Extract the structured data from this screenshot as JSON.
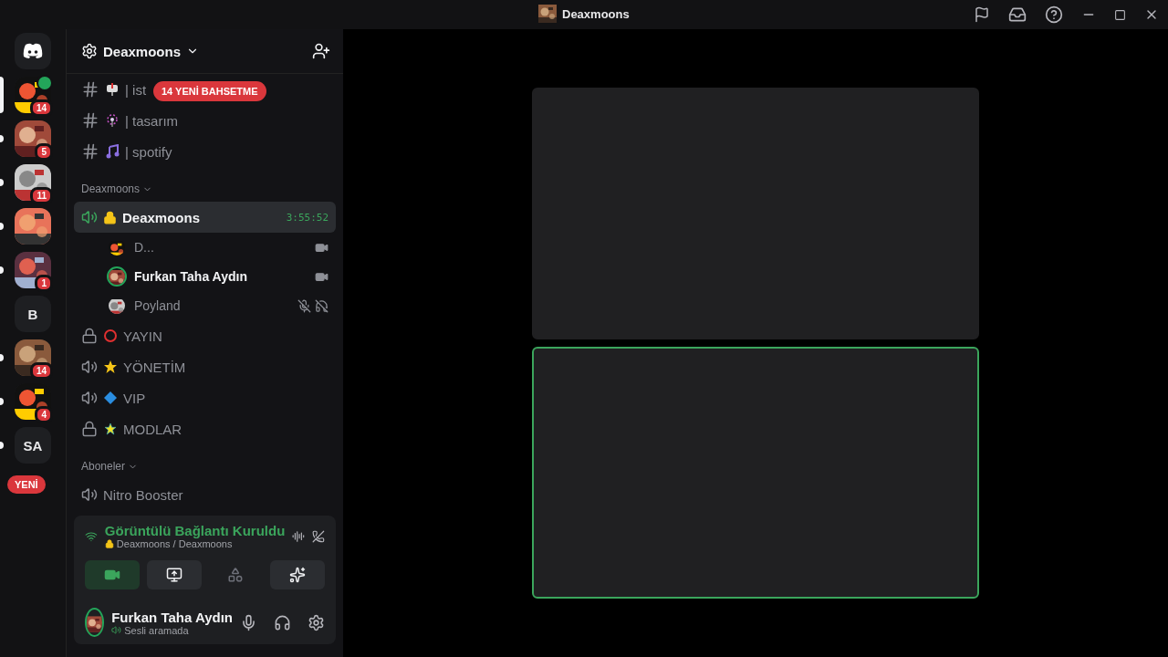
{
  "title_bar": {
    "title": "Deaxmoons"
  },
  "servers": [
    {
      "kind": "home",
      "unread": false,
      "selected": false
    },
    {
      "kind": "picture",
      "badge": "14",
      "unread": false,
      "selected": true,
      "video": true
    },
    {
      "kind": "picture",
      "badge": "5",
      "unread": true,
      "selected": false
    },
    {
      "kind": "picture",
      "badge": "11",
      "unread": true,
      "selected": false
    },
    {
      "kind": "picture",
      "unread": true,
      "selected": false
    },
    {
      "kind": "picture",
      "badge": "1",
      "unread": true,
      "selected": false
    },
    {
      "kind": "letters",
      "label": "B",
      "unread": false,
      "selected": false
    },
    {
      "kind": "picture",
      "badge": "14",
      "unread": true,
      "selected": false
    },
    {
      "kind": "picture",
      "badge": "4",
      "unread": true,
      "selected": false
    },
    {
      "kind": "letters",
      "label": "SA",
      "unread": true,
      "selected": false
    }
  ],
  "new_pill": "YENİ",
  "server_header": {
    "name": "Deaxmoons"
  },
  "mention_pill": "14 YENİ BAHSETME",
  "channels": [
    {
      "kind": "text",
      "name": "| ist"
    },
    {
      "kind": "text",
      "name": "| tasarım"
    },
    {
      "kind": "text",
      "name": "| spotify"
    },
    {
      "kind": "category",
      "name": "Deaxmoons"
    },
    {
      "kind": "voice",
      "name": "Deaxmoons",
      "selected": true,
      "timer": "3:55:52",
      "members": [
        {
          "name": "D...",
          "speaking": false,
          "video": true,
          "muted": false
        },
        {
          "name": "Furkan Taha Aydın",
          "speaking": true,
          "video": true,
          "muted": false
        },
        {
          "name": "Poyland",
          "speaking": false,
          "video": false,
          "muted": true
        }
      ]
    },
    {
      "kind": "locked",
      "name": "YAYIN"
    },
    {
      "kind": "voice",
      "name": "YÖNETİM",
      "selected": false
    },
    {
      "kind": "voice",
      "name": "VIP",
      "selected": false
    },
    {
      "kind": "locked",
      "name": "MODLAR"
    },
    {
      "kind": "category",
      "name": "Aboneler"
    },
    {
      "kind": "voice",
      "name": "Nitro Booster",
      "selected": false
    }
  ],
  "voice_panel": {
    "status": "Görüntülü Bağlantı Kuruldu",
    "location": "Deaxmoons / Deaxmoons",
    "buttons": [
      {
        "kind": "camera",
        "selected": true
      },
      {
        "kind": "screen",
        "selected": false
      },
      {
        "kind": "activity",
        "selected": false
      },
      {
        "kind": "soundboard",
        "selected": false
      }
    ]
  },
  "user": {
    "name": "Furkan Taha Aydın",
    "status": "Sesli aramada"
  },
  "video_tiles": [
    {
      "speaking": false
    },
    {
      "speaking": true
    }
  ]
}
